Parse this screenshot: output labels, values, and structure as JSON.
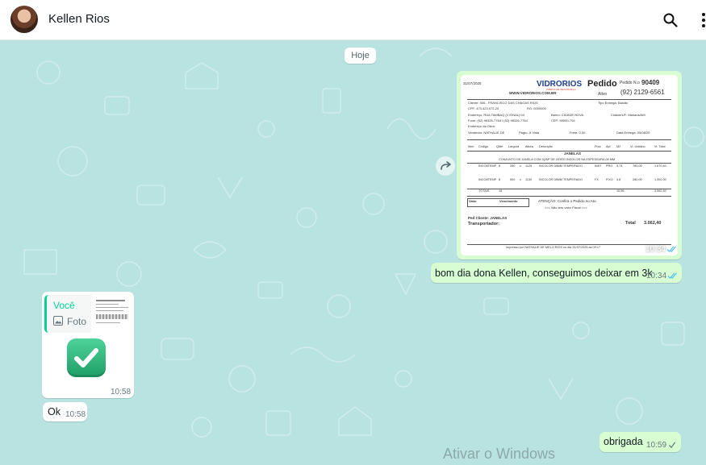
{
  "header": {
    "contact_name": "Kellen Rios"
  },
  "chat": {
    "date_label": "Hoje",
    "messages": [
      {
        "type": "image",
        "direction": "out",
        "time": "10:34",
        "status": "read",
        "invoice": {
          "date": "31/07/2025",
          "brand": "VIDRORIOS",
          "brand_sub": "VIDROS DE SEGURANÇA",
          "doc_title": "Pedido",
          "order_label": "Pedido N.o",
          "order_number": "90409",
          "status": "Ativo",
          "phone": "(92) 2129-6561",
          "website": "WWW.VIDRORIOS.COM.BR",
          "client": "Cliente: 506 - FRANCISCO DAS CHAGAS RIOS",
          "cpf": "CPF: 473.423.072-20",
          "rg": "RG: 0000000",
          "address": "Endereço: RUA TAMBAQ (V EINAL) 04",
          "bairro": "Bairro: CIDADE NOVA",
          "city": "Cidade/UF: Manaus/AM",
          "fone": "Fone: (92) 98326-7764 / (92) 98326-7764",
          "cep": "CEP: 69000-704",
          "delivery_type": "Tipo Entrega: Balcão",
          "obra": "Endereço da Obra:",
          "seller": "Vendedor: NATHALIE DE",
          "payment": "Pagto: À Vista",
          "frete": "Frete: 0,00",
          "delivery_date": "Data Entrega: 05/08/25",
          "table_headers": [
            "Item",
            "Código",
            "Qtde",
            "Largura",
            "Altura",
            "Descrição",
            "Proc",
            "Apl",
            "M2",
            "Vl. Unitário",
            "Vl. Total"
          ],
          "group_title": "JANELAS",
          "group_desc": "CONJUNTO DE JANELA COM 5(2M² DE VIDRO INCOLOR NA ESPESSURA 08 MM",
          "rows": [
            [
              "INCO8TEMP",
              "8",
              "340",
              "x",
              "1125",
              "INCOLOR 08MM TEMPERADO",
              "INST",
              "PRO",
              "3,74",
              "780,00",
              "1.670,40"
            ],
            [
              "INCO8TEMP",
              "8",
              "500",
              "x",
              "1130",
              "INCOLOR 08MM TEMPERADO",
              "FX",
              "FIXO",
              "4,8",
              "280,00",
              "1.392,00"
            ]
          ],
          "totals_label": "TOTAIS",
          "totals_qty": "16",
          "totals_m2": "10,56",
          "totals_value": "3.062,40",
          "valor_label": "Valor",
          "vencimento_label": "Vencimento",
          "attention": "ATENÇÃO: Confira o Pedido no Ato.",
          "no_fiscal": "<<< Não tem valor Fiscal >>>",
          "ped_cliente": "Ped Cliente: JANELAS",
          "transportador": "Transportador:",
          "total_label": "Total",
          "total_value": "3.062,40",
          "footer": "Impresso por NATHALIE DE MELO RIOS no dia 31/07/2025 às 09:17"
        }
      },
      {
        "type": "text",
        "direction": "out",
        "text": "bom dia dona Kellen, conseguimos deixar em 3k",
        "time": "10:34",
        "status": "read"
      },
      {
        "type": "sticker-reply",
        "direction": "in",
        "quote_author": "Você",
        "quote_type": "Foto",
        "emoji": "✅",
        "time": "10:58"
      },
      {
        "type": "text",
        "direction": "in",
        "text": "Ok",
        "time": "10:58"
      },
      {
        "type": "text",
        "direction": "out",
        "text": "obrigada",
        "time": "10:59",
        "status": "sent"
      }
    ]
  },
  "system": {
    "watermark": "Ativar o Windows"
  },
  "colors": {
    "outgoing_bubble": "#d9fdd3",
    "incoming_bubble": "#ffffff",
    "chat_background": "#b8e3e1",
    "read_tick": "#53bdeb",
    "accent": "#06cf9c",
    "check_emoji": "#2fb67c"
  },
  "icons": [
    "search-icon",
    "kebab-menu-icon",
    "forward-icon",
    "photo-icon",
    "double-check-icon",
    "single-check-icon"
  ]
}
